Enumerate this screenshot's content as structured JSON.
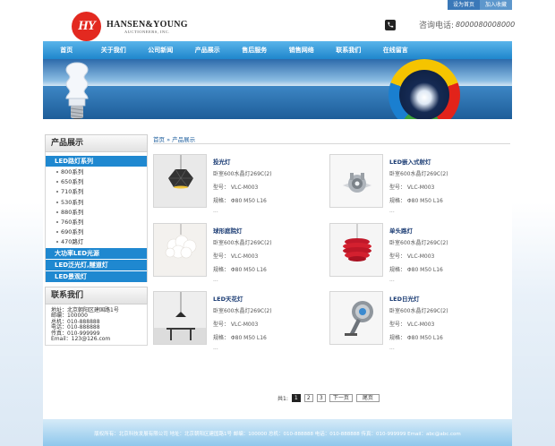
{
  "toplinks": {
    "home": "设为首页",
    "favorite": "加入收藏"
  },
  "logo": {
    "mark": "HY",
    "name": "HANSEN&YOUNG",
    "sub": "AUCTIONEERS, INC."
  },
  "phone": {
    "label": "咨询电话:",
    "number": "8000080008000"
  },
  "nav": [
    "首页",
    "关于我们",
    "公司新闻",
    "产品展示",
    "售后服务",
    "销售网络",
    "联系我们",
    "在线留言"
  ],
  "sidebar": {
    "title": "产品展示",
    "categories": [
      {
        "label": "LED路灯系列",
        "subs": [
          "800系列",
          "650系列",
          "710系列",
          "530系列",
          "880系列",
          "760系列",
          "690系列",
          "470路灯"
        ]
      },
      {
        "label": "大功率LED光源",
        "subs": []
      },
      {
        "label": "LED泛光灯,隧道灯",
        "subs": []
      },
      {
        "label": "LED景观灯",
        "subs": []
      }
    ]
  },
  "contact": {
    "title": "联系我们",
    "lines": [
      "地址：北京朝阳区建国路1号",
      "邮编：100000",
      "总机：010-888888",
      "电话：010-888888",
      "传真：010-999999",
      "Email：123@126.com"
    ]
  },
  "breadcrumb": {
    "home": "首页",
    "sep": "»",
    "current": "产品展示"
  },
  "products": [
    {
      "name": "投光灯",
      "desc": "卧室600水晶灯269C(2)",
      "model": "型号：  VLC-M003",
      "spec": "规格：  Φ80  M50  L16",
      "more": "..."
    },
    {
      "name": "LED嵌入式射灯",
      "desc": "卧室600水晶灯269C(2)",
      "model": "型号：  VLC-M003",
      "spec": "规格：  Φ80  M50  L16",
      "more": "..."
    },
    {
      "name": "球形庭院灯",
      "desc": "卧室600水晶灯269C(2)",
      "model": "型号：  VLC-M003",
      "spec": "规格：  Φ80  M50  L16",
      "more": "..."
    },
    {
      "name": "单头路灯",
      "desc": "卧室600水晶灯269C(2)",
      "model": "型号：  VLC-M003",
      "spec": "规格：  Φ80  M50  L16",
      "more": "..."
    },
    {
      "name": "LED天花灯",
      "desc": "卧室600水晶灯269C(2)",
      "model": "型号：  VLC-M003",
      "spec": "规格：  Φ80  M50  L16",
      "more": "..."
    },
    {
      "name": "LED日光灯",
      "desc": "卧室600水晶灯269C(2)",
      "model": "型号：  VLC-M003",
      "spec": "规格：  Φ80  M50  L16",
      "more": "..."
    }
  ],
  "pager": {
    "total": "共1:",
    "pages": [
      "1",
      "2",
      "3"
    ],
    "next": "下一页",
    "last": "尾页"
  },
  "footer": "版权所有：北京科技发展有限公司  地址：北京朝阳区建国路1号  邮编：100000  总机：010-888888  电话：010-888888  传真：010-999999  Email：abc@abc.com"
}
